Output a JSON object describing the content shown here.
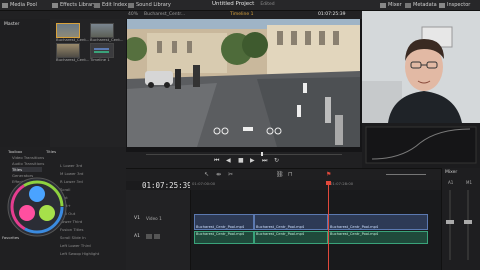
{
  "topbar": {
    "media_pool": "Media Pool",
    "effects_library": "Effects Library",
    "edit_index": "Edit Index",
    "sound_library": "Sound Library",
    "project_title": "Untitled Project",
    "project_status": "Edited",
    "mixer": "Mixer",
    "metadata": "Metadata",
    "inspector": "Inspector"
  },
  "subbar": {
    "zoom": "40%",
    "clip_name": "Bucharest_Centr...",
    "timeline_name": "Timeline 1",
    "timecode": "01:07:25:39"
  },
  "media_pool": {
    "master": "Master",
    "clips": [
      "Bucharest_Cent...",
      "Bucharest_Cent...",
      "Bucharest_Cent...",
      "Timeline 1"
    ]
  },
  "effects": {
    "toolbox_header": "Toolbox",
    "items": [
      "Video Transitions",
      "Audio Transitions",
      "Titles",
      "Generators",
      "Effects"
    ],
    "titles_header": "Titles",
    "title_list": [
      "L Lower 3rd",
      "M Lower 3rd",
      "R Lower 3rd",
      "Scroll",
      "Text",
      "Text+",
      "Call Out",
      "Lower Third",
      "Fusion Titles",
      "Scroll Slide In",
      "Left Lower Third",
      "Left Swoop Highlight"
    ],
    "favorites": "Favorites"
  },
  "timeline": {
    "timecode": "01:07:25:39",
    "ruler_start": "01:07:00:00",
    "ruler_mid": "01:07:28:00",
    "video_track": "V1",
    "video_track_name": "Video 1",
    "audio_track": "A1",
    "video_clips": [
      "Bucharest_Centr_Pool.mp4",
      "Bucharest_Centr_Pool.mp4",
      "Bucharest_Centr_Pool.mp4"
    ],
    "audio_clips": [
      "Bucharest_Centr_Pool.mp4",
      "Bucharest_Centr_Pool.mp4",
      "Bucharest_Centr_Pool.mp4"
    ]
  },
  "mixer": {
    "label": "Mixer",
    "a1": "A1",
    "main": "M1"
  },
  "colors": {
    "accent": "#d9a23b",
    "playhead": "#e0493c",
    "video_clip": "#2d3a55",
    "audio_clip": "#1f4a3b"
  }
}
